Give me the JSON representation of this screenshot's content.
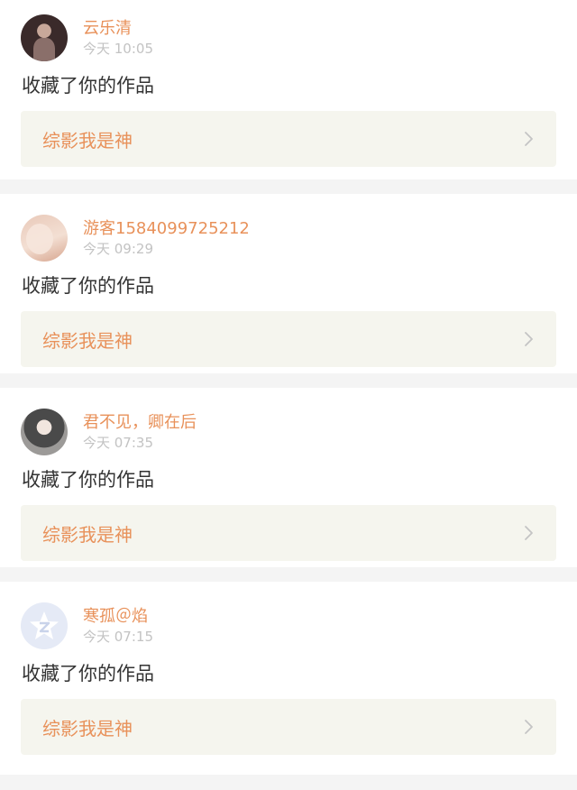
{
  "notifications": [
    {
      "username": "云乐清",
      "time": "今天 10:05",
      "action": "收藏了你的作品",
      "work_title": "综影我是神",
      "avatar_icon": "avatar-photo-costume"
    },
    {
      "username": "游客1584099725212",
      "time": "今天 09:29",
      "action": "收藏了你的作品",
      "work_title": "综影我是神",
      "avatar_icon": "avatar-photo-face"
    },
    {
      "username": "君不见，卿在后",
      "time": "今天 07:35",
      "action": "收藏了你的作品",
      "work_title": "综影我是神",
      "avatar_icon": "avatar-photo-girl"
    },
    {
      "username": "寒孤＠焰",
      "time": "今天 07:15",
      "action": "收藏了你的作品",
      "work_title": "综影我是神",
      "avatar_icon": "avatar-default-star"
    }
  ],
  "colors": {
    "accent": "#e8915a",
    "time": "#c3c3c3",
    "work_bg": "#f5f5ee",
    "separator": "#f4f4f4"
  }
}
